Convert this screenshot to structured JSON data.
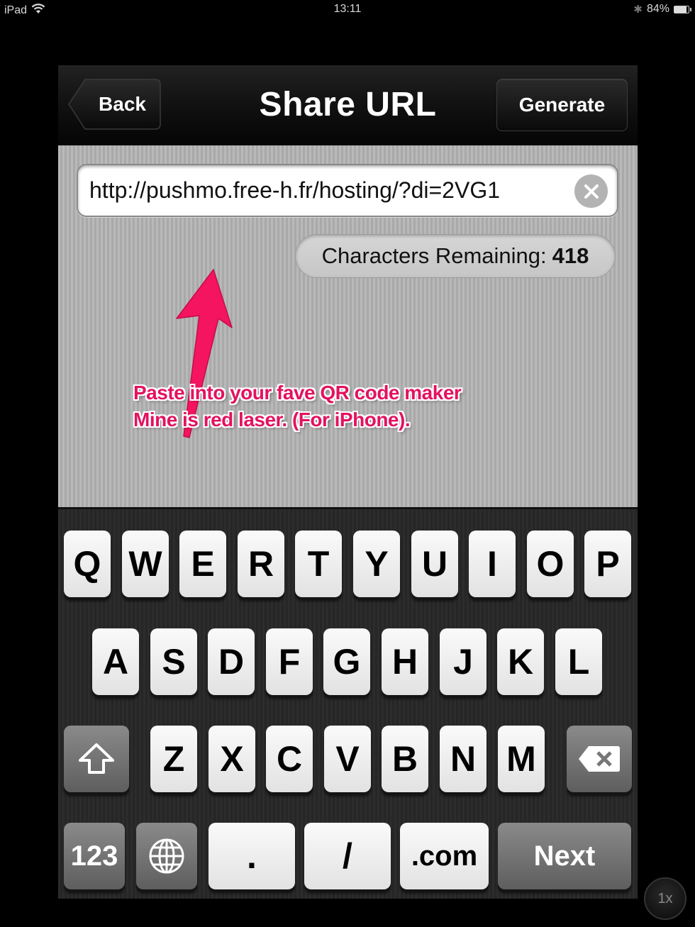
{
  "status_bar": {
    "device": "iPad",
    "time": "13:11",
    "battery_percent_label": "84%",
    "battery_level": 0.84
  },
  "navbar": {
    "title": "Share URL",
    "back_label": "Back",
    "generate_label": "Generate"
  },
  "url_field": {
    "value": "http://pushmo.free-h.fr/hosting/?di=2VG1"
  },
  "counter": {
    "label": "Characters Remaining:",
    "value": "418"
  },
  "annotation": {
    "line1": "Paste into your fave QR code maker",
    "line2": "Mine is red laser. (For iPhone).",
    "color": "#e3125f"
  },
  "keyboard": {
    "row1": [
      "Q",
      "W",
      "E",
      "R",
      "T",
      "Y",
      "U",
      "I",
      "O",
      "P"
    ],
    "row2": [
      "A",
      "S",
      "D",
      "F",
      "G",
      "H",
      "J",
      "K",
      "L"
    ],
    "row3": [
      "Z",
      "X",
      "C",
      "V",
      "B",
      "N",
      "M"
    ],
    "row4": {
      "numbers": "123",
      "dot": ".",
      "slash": "/",
      "dotcom": ".com",
      "next": "Next"
    }
  },
  "zoom_badge": "1x"
}
